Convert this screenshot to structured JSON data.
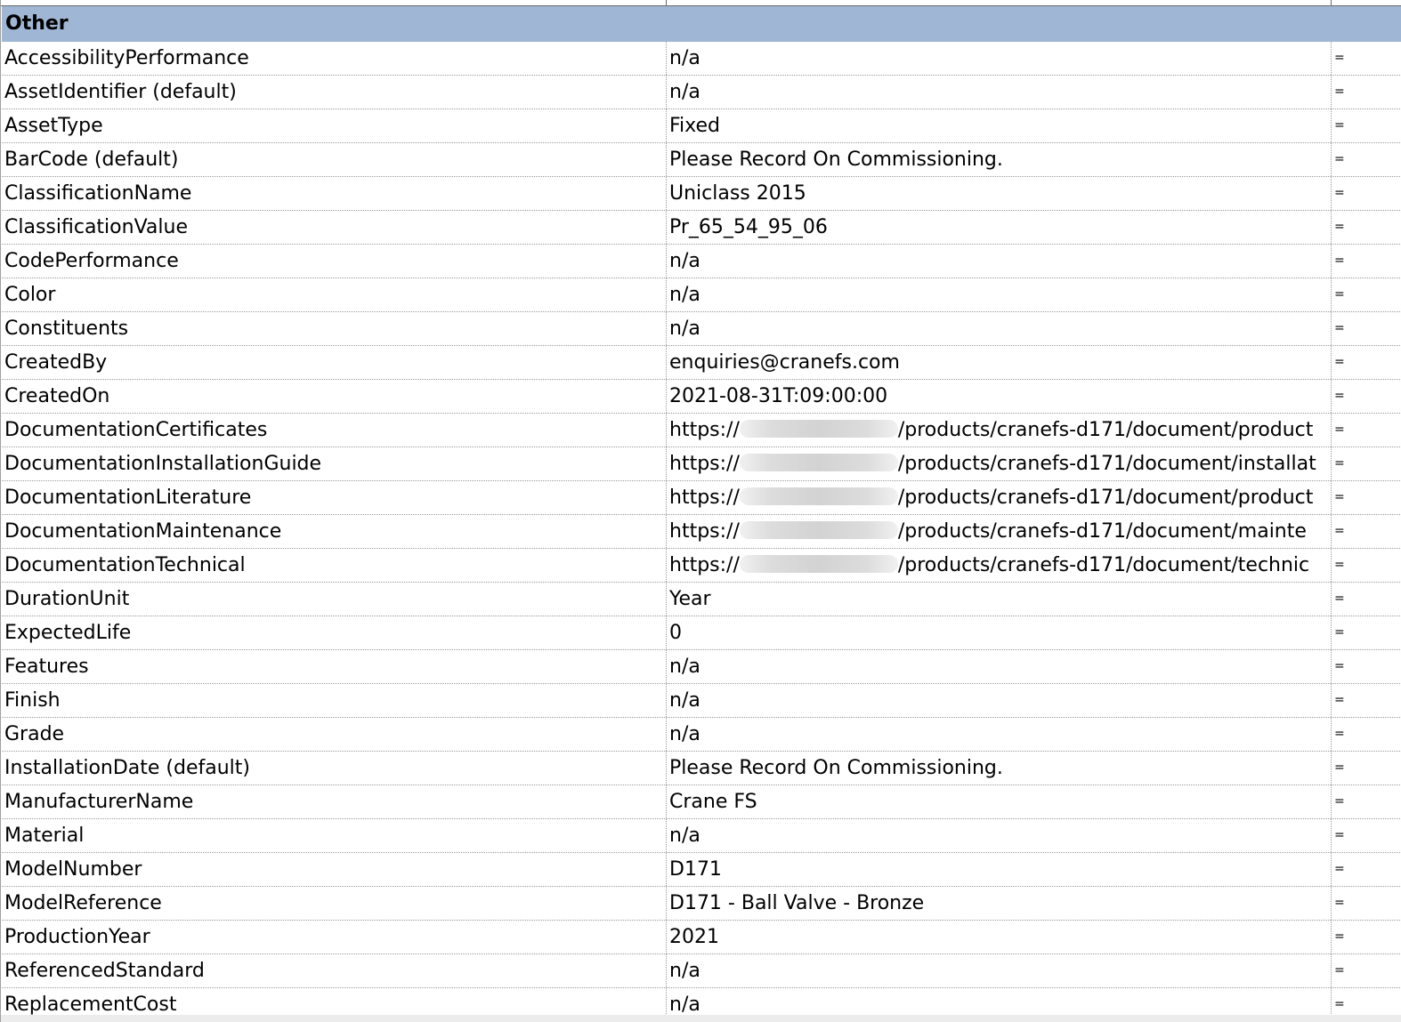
{
  "group": {
    "title": "Other"
  },
  "rows": [
    {
      "name": "AccessibilityPerformance",
      "value": "n/a",
      "flag": "="
    },
    {
      "name": "AssetIdentifier (default)",
      "value": "n/a",
      "flag": "="
    },
    {
      "name": "AssetType",
      "value": "Fixed",
      "flag": "="
    },
    {
      "name": "BarCode (default)",
      "value": "Please Record On Commissioning.",
      "flag": "="
    },
    {
      "name": "ClassificationName",
      "value": "Uniclass 2015",
      "flag": "="
    },
    {
      "name": "ClassificationValue",
      "value": "Pr_65_54_95_06",
      "flag": "="
    },
    {
      "name": "CodePerformance",
      "value": "n/a",
      "flag": "="
    },
    {
      "name": "Color",
      "value": "n/a",
      "flag": "="
    },
    {
      "name": "Constituents",
      "value": "n/a",
      "flag": "="
    },
    {
      "name": "CreatedBy",
      "value": "enquiries@cranefs.com",
      "flag": "="
    },
    {
      "name": "CreatedOn",
      "value": "2021-08-31T:09:00:00",
      "flag": "="
    },
    {
      "name": "DocumentationCertificates",
      "value_prefix": "https://",
      "value_suffix": "/products/cranefs-d171/document/product",
      "flag": "="
    },
    {
      "name": "DocumentationInstallationGuide",
      "value_prefix": "https://",
      "value_suffix": "/products/cranefs-d171/document/installat",
      "flag": "="
    },
    {
      "name": "DocumentationLiterature",
      "value_prefix": "https://",
      "value_suffix": "/products/cranefs-d171/document/product",
      "flag": "="
    },
    {
      "name": "DocumentationMaintenance",
      "value_prefix": "https://",
      "value_suffix": "/products/cranefs-d171/document/mainte",
      "flag": "="
    },
    {
      "name": "DocumentationTechnical",
      "value_prefix": "https://",
      "value_suffix": "/products/cranefs-d171/document/technic",
      "flag": "="
    },
    {
      "name": "DurationUnit",
      "value": "Year",
      "flag": "="
    },
    {
      "name": "ExpectedLife",
      "value": "0",
      "flag": "="
    },
    {
      "name": "Features",
      "value": "n/a",
      "flag": "="
    },
    {
      "name": "Finish",
      "value": "n/a",
      "flag": "="
    },
    {
      "name": "Grade",
      "value": "n/a",
      "flag": "="
    },
    {
      "name": "InstallationDate (default)",
      "value": "Please Record On Commissioning.",
      "flag": "="
    },
    {
      "name": "ManufacturerName",
      "value": "Crane FS",
      "flag": "="
    },
    {
      "name": "Material",
      "value": "n/a",
      "flag": "="
    },
    {
      "name": "ModelNumber",
      "value": "D171",
      "flag": "="
    },
    {
      "name": "ModelReference",
      "value": "D171 - Ball Valve - Bronze",
      "flag": "="
    },
    {
      "name": "ProductionYear",
      "value": "2021",
      "flag": "="
    },
    {
      "name": "ReferencedStandard",
      "value": "n/a",
      "flag": "="
    },
    {
      "name": "ReplacementCost",
      "value": "n/a",
      "flag": "="
    }
  ],
  "colors": {
    "group_header_bg": "#9fb6d5",
    "grid_line": "#9a9a9a",
    "text": "#000000"
  }
}
